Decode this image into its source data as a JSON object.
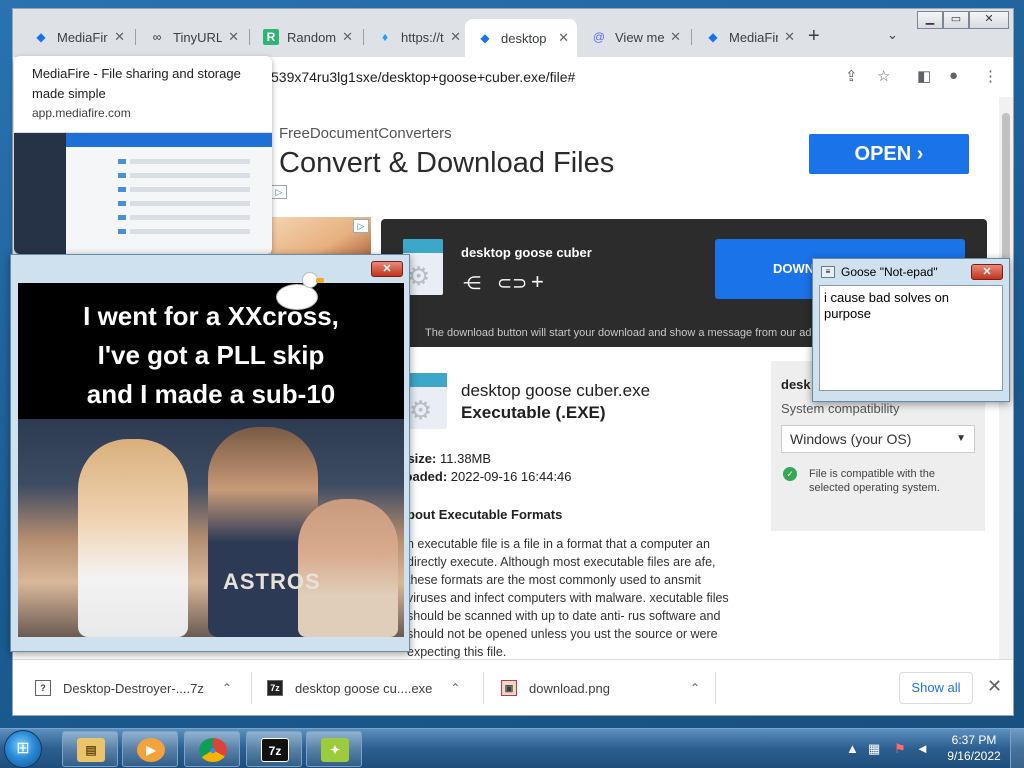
{
  "browser": {
    "tabs": [
      {
        "title": "MediaFire",
        "icon": "mediafire-icon"
      },
      {
        "title": "TinyURL",
        "icon": "tinyurl-icon"
      },
      {
        "title": "Random",
        "icon": "random-icon"
      },
      {
        "title": "https://t",
        "icon": "twitter-icon"
      },
      {
        "title": "desktop",
        "icon": "mediafire-icon"
      },
      {
        "title": "View me",
        "icon": "at-icon"
      },
      {
        "title": "MediaFire",
        "icon": "mediafire-icon"
      }
    ],
    "active_tab": 4,
    "url": "539x74ru3lg1sxe/desktop+goose+cuber.exe/file#",
    "scroll_position": 0.0
  },
  "hover_card": {
    "title": "MediaFire - File sharing and storage made simple",
    "domain": "app.mediafire.com"
  },
  "ad_banner": {
    "brand": "FreeDocumentConverters",
    "headline": "Convert & Download Files",
    "button": "OPEN"
  },
  "file_card": {
    "title": "desktop goose cuber",
    "download_label": "DOWN",
    "note": "The download button will start your download and show a message from our ad"
  },
  "file_info": {
    "name": "desktop goose cuber.exe",
    "type": "Executable (.EXE)",
    "size_label": "le size:",
    "size": "11.38MB",
    "uploaded_label": "ploaded:",
    "uploaded": "2022-09-16 16:44:46",
    "about_heading": "bout Executable Formats",
    "about_text": "n executable file is a file in a format that a computer an directly execute. Although most executable files are afe, these formats are the most commonly used to ansmit viruses and infect computers with malware. xecutable files should be scanned with up to date anti- rus software and should not be opened unless you ust the source or were expecting this file."
  },
  "compat": {
    "heading": "desk",
    "label": "System compatibility",
    "os": "Windows (your OS)",
    "message": "File is compatible with the selected operating system."
  },
  "downloads": [
    {
      "name": "Desktop-Destroyer-....7z",
      "icon": "7z-file-icon"
    },
    {
      "name": "desktop goose cu....exe",
      "icon": "7z-file-icon"
    },
    {
      "name": "download.png",
      "icon": "image-file-icon"
    }
  ],
  "shelf": {
    "show_all": "Show all"
  },
  "meme": {
    "lines": [
      "I went for a XXcross,",
      "I've got a PLL skip",
      "and I made a sub-10"
    ],
    "jersey": "ASTROS"
  },
  "notepad": {
    "title": "Goose \"Not-epad\"",
    "text": "i cause bad solves on purpose"
  },
  "taskbar": {
    "apps": [
      "explorer-icon",
      "media-player-icon",
      "chrome-icon",
      "7zip-icon",
      "goose-icon"
    ],
    "seven_zip_label": "7z",
    "time": "6:37 PM",
    "date": "9/16/2022"
  },
  "colors": {
    "accent": "#1a73e8",
    "card_dark": "#2c2c2c",
    "compat_ok": "#34a853"
  }
}
